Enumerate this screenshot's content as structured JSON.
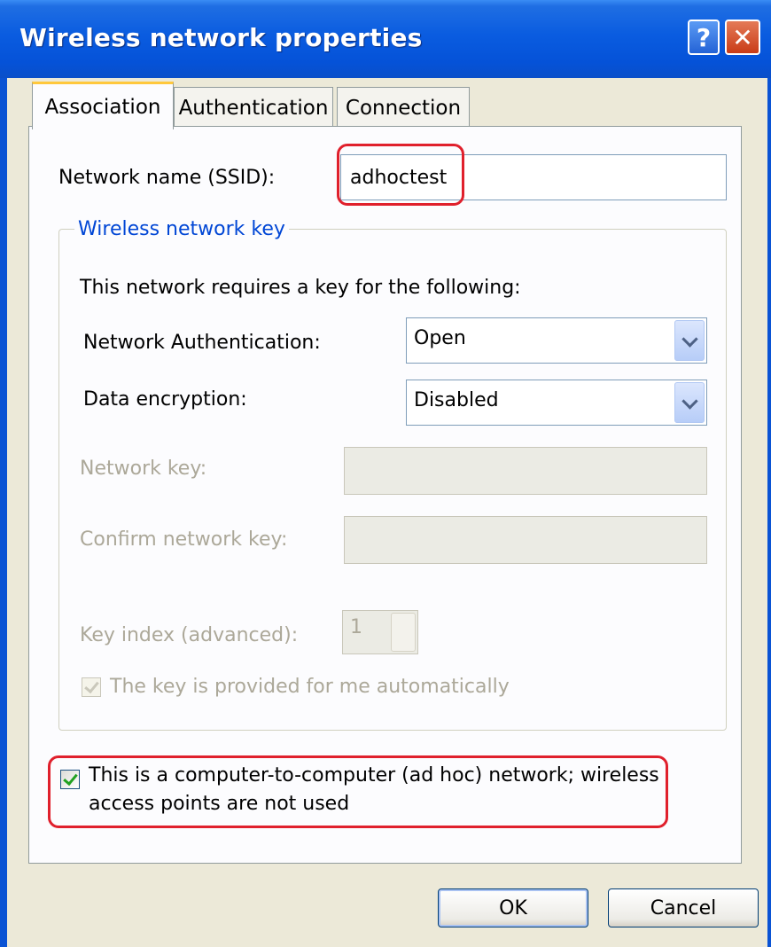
{
  "window": {
    "title": "Wireless network properties"
  },
  "titlebar_buttons": {
    "help": "?",
    "close": "✕"
  },
  "tabs": [
    {
      "label": "Association",
      "active": true
    },
    {
      "label": "Authentication",
      "active": false
    },
    {
      "label": "Connection",
      "active": false
    }
  ],
  "association": {
    "ssid_label": "Network name (SSID):",
    "ssid_value": "adhoctest",
    "group_title": "Wireless network key",
    "requires_key_text": "This network requires a key for the following:",
    "auth_label": "Network Authentication:",
    "auth_value": "Open",
    "encryption_label": "Data encryption:",
    "encryption_value": "Disabled",
    "network_key_label": "Network key:",
    "confirm_key_label": "Confirm network key:",
    "key_index_label": "Key index (advanced):",
    "key_index_value": "1",
    "auto_key_label": "The key is provided for me automatically",
    "auto_key_checked": true,
    "adhoc_label_line1": "This is a computer-to-computer (ad hoc) network; wireless",
    "adhoc_label_line2": "access points are not used",
    "adhoc_checked": true
  },
  "buttons": {
    "ok": "OK",
    "cancel": "Cancel"
  },
  "colors": {
    "titlebar": "#0a5ce0",
    "highlight": "#e0202c",
    "group_title": "#0046d5"
  }
}
